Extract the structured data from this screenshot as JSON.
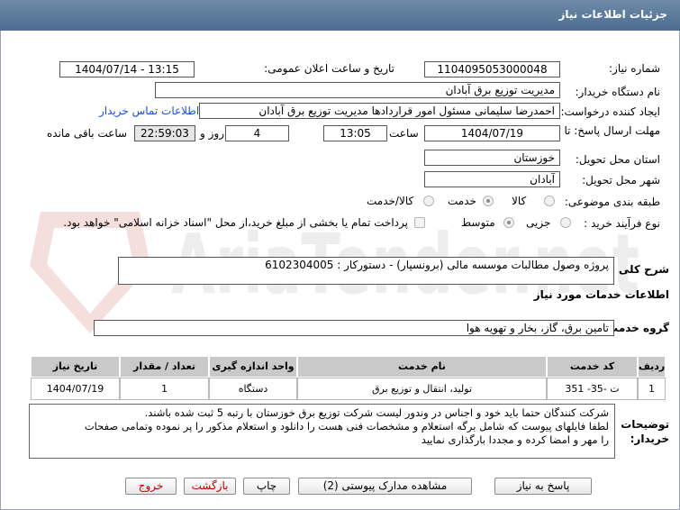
{
  "header": {
    "title": "جزئیات اطلاعات نیاز"
  },
  "watermark": {
    "text": "AriaTender.net"
  },
  "fields": {
    "need_number_label": "شماره نیاز:",
    "need_number": "1104095053000048",
    "announce_label": "تاریخ و ساعت اعلان عمومی:",
    "announce_value": "1404/07/14 - 13:15",
    "buyer_label": "نام دستگاه خریدار:",
    "buyer_value": "مدیریت توزیع برق آبادان",
    "creator_label": "ایجاد کننده درخواست:",
    "creator_value": "احمدرضا سلیمانی مسئول امور قراردادها مدیریت توزیع برق آبادان",
    "contact_link": "اطلاعات تماس خریدار",
    "deadline_label": "مهلت ارسال پاسخ: تا تاریخ:",
    "deadline_date": "1404/07/19",
    "time_label": "ساعت",
    "deadline_time": "13:05",
    "days_value": "4",
    "days_label": "روز و",
    "remaining_value": "22:59:03",
    "remaining_label": "ساعت باقی مانده",
    "province_label": "استان محل تحویل:",
    "province_value": "خوزستان",
    "city_label": "شهر محل تحویل:",
    "city_value": "آبادان",
    "category_label": "طبقه بندی موضوعی:",
    "category_options": [
      "کالا",
      "خدمت",
      "کالا/خدمت"
    ],
    "process_label": "نوع فرآیند خرید :",
    "process_options": [
      "جزیی",
      "متوسط"
    ],
    "payment_note": "پرداخت تمام یا بخشی از مبلغ خرید،از محل \"اسناد خزانه اسلامی\" خواهد بود."
  },
  "description": {
    "label": "شرح کلی نیاز:",
    "value": "پروژه وصول مطالبات موسسه مالی (برونسپار) - دستورکار : 6102304005"
  },
  "services": {
    "section_title": "اطلاعات خدمات مورد نیاز",
    "group_label": "گروه خدمت:",
    "group_value": "تامین برق، گاز، بخار و تهویه هوا",
    "columns": [
      "ردیف",
      "کد خدمت",
      "نام خدمت",
      "واحد اندازه گیری",
      "تعداد / مقدار",
      "تاریخ نیاز"
    ],
    "rows": [
      [
        "1",
        "ت -35- 351",
        "تولید، انتقال و توزیع برق",
        "دستگاه",
        "1",
        "1404/07/19"
      ]
    ]
  },
  "notes": {
    "label": "توضیحات خریدار:",
    "lines": [
      "شرکت کنندگان حتما باید خود و اجناس در وندور لیست شرکت توزیع برق خوزستان با رتبه 5 ثبت شده باشند.",
      "لطفا فایلهای پیوست که شامل برگه استعلام و مشخصات فنی هست را دانلود و استعلام مذکور را پر نموده وتمامی صفحات",
      "را مهر و امضا کرده و مجددا بارگذاری نمایید"
    ]
  },
  "buttons": {
    "reply": "پاسخ به نیاز",
    "attachments": "مشاهده مدارک پیوستی (2)",
    "print": "چاپ",
    "back": "بازگشت",
    "exit": "خروج"
  }
}
